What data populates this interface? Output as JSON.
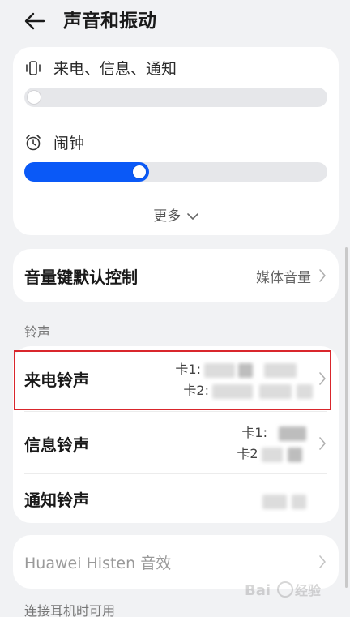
{
  "header": {
    "title": "声音和振动",
    "back_icon": "arrow-left-icon"
  },
  "volume": {
    "ringtone_label": "来电、信息、通知",
    "ringtone_level": 0.0,
    "alarm_label": "闹钟",
    "alarm_level": 0.37,
    "more_label": "更多",
    "accent_color": "#0a59f7"
  },
  "volume_key": {
    "label": "音量键默认控制",
    "value": "媒体音量"
  },
  "ringtones_section": {
    "title": "铃声",
    "items": [
      {
        "label": "来电铃声",
        "sim1_prefix": "卡1:",
        "sim2_prefix": "卡2:"
      },
      {
        "label": "信息铃声",
        "sim1_prefix": "卡1:",
        "sim2_prefix": "卡2"
      },
      {
        "label": "通知铃声"
      }
    ]
  },
  "histen": {
    "label": "Huawei Histen 音效"
  },
  "headset_section": {
    "title": "连接耳机时可用"
  },
  "highlight_color": "#d9262c"
}
